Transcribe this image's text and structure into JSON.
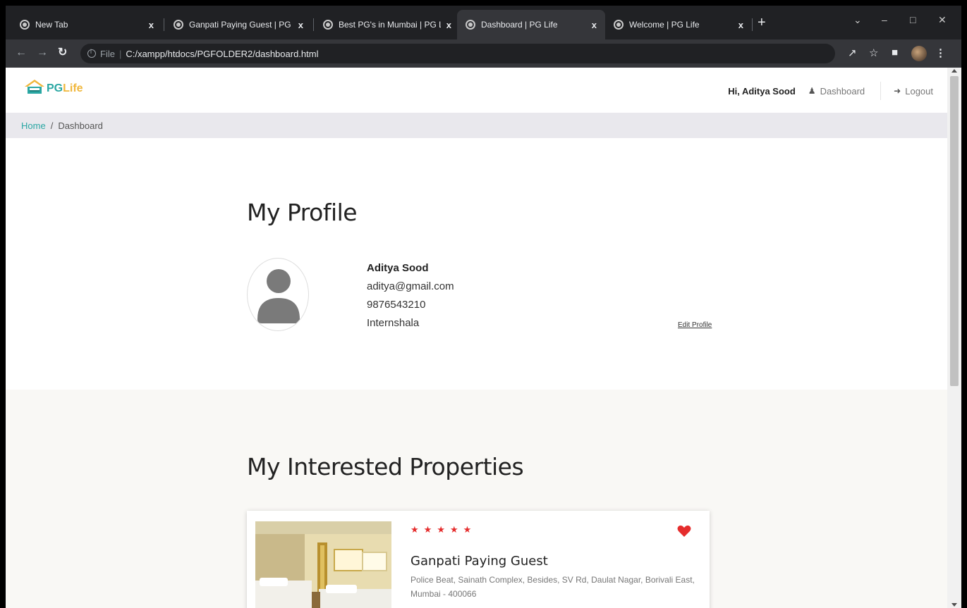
{
  "browser": {
    "tabs": [
      {
        "title": "New Tab",
        "active": false
      },
      {
        "title": "Ganpati Paying Guest | PG Life",
        "active": false
      },
      {
        "title": "Best PG's in Mumbai | PG Life",
        "active": false
      },
      {
        "title": "Dashboard | PG Life",
        "active": true
      },
      {
        "title": "Welcome | PG Life",
        "active": false
      }
    ],
    "close_glyph": "x",
    "new_tab_glyph": "+",
    "url_scheme": "File",
    "url_separator": "|",
    "url_path": "C:/xampp/htdocs/PGFOLDER2/dashboard.html"
  },
  "header": {
    "logo_pg": "PG",
    "logo_life": "Life",
    "greeting": "Hi, Aditya Sood",
    "dashboard_label": "Dashboard",
    "logout_label": "Logout"
  },
  "breadcrumb": {
    "home": "Home",
    "separator": "/",
    "current": "Dashboard"
  },
  "profile": {
    "heading": "My Profile",
    "name": "Aditya Sood",
    "email": "aditya@gmail.com",
    "phone": "9876543210",
    "college": "Internshala",
    "edit_label": "Edit Profile"
  },
  "interested": {
    "heading": "My Interested Properties",
    "properties": [
      {
        "stars": 5,
        "name": "Ganpati Paying Guest",
        "address": "Police Beat, Sainath Complex, Besides, SV Rd, Daulat Nagar, Borivali East, Mumbai - 400066",
        "interested": true
      }
    ]
  },
  "colors": {
    "accent_teal": "#2aa7a3",
    "accent_yellow": "#f0b73c",
    "star_red": "#e52d2d",
    "breadcrumb_bg": "#e9e8ed",
    "section_alt_bg": "#f9f8f5"
  }
}
